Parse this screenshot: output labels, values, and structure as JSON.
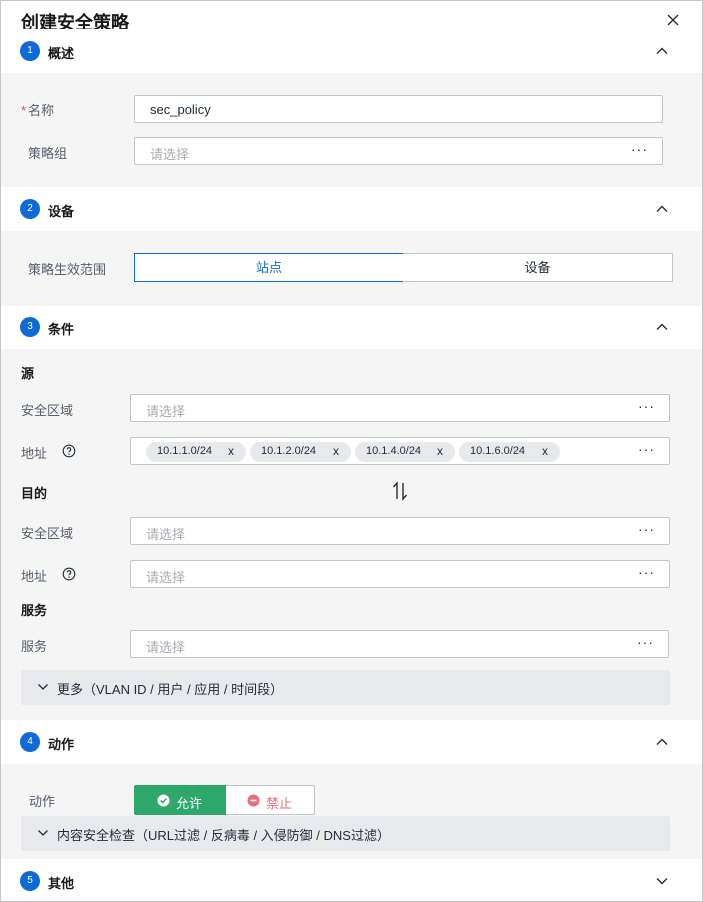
{
  "dialog": {
    "title": "创建安全策略"
  },
  "sections": {
    "overview": {
      "step": "1",
      "title": "概述"
    },
    "device": {
      "step": "2",
      "title": "设备"
    },
    "condition": {
      "step": "3",
      "title": "条件"
    },
    "action": {
      "step": "4",
      "title": "动作"
    },
    "other": {
      "step": "5",
      "title": "其他"
    }
  },
  "overview": {
    "name_required": "*",
    "name_label": "名称",
    "name_value": "sec_policy",
    "group_label": "策略组",
    "group_placeholder": "请选择"
  },
  "device": {
    "scope_label": "策略生效范围",
    "scope_options": [
      "站点",
      "设备"
    ],
    "scope_selected": "站点"
  },
  "condition": {
    "source_title": "源",
    "source_zone_label": "安全区域",
    "source_zone_placeholder": "请选择",
    "source_addr_label": "地址",
    "source_addresses": [
      "10.1.1.0/24",
      "10.1.2.0/24",
      "10.1.4.0/24",
      "10.1.6.0/24"
    ],
    "chip_remove": "x",
    "dest_title": "目的",
    "dest_zone_label": "安全区域",
    "dest_zone_placeholder": "请选择",
    "dest_addr_label": "地址",
    "dest_addr_placeholder": "请选择",
    "service_title": "服务",
    "service_label": "服务",
    "service_placeholder": "请选择",
    "more_label": "更多（VLAN ID / 用户 / 应用 / 时间段）"
  },
  "action": {
    "label": "动作",
    "allow": "允许",
    "deny": "禁止",
    "selected": "允许",
    "content_check": "内容安全检查（URL过滤 / 反病毒 / 入侵防御 / DNS过滤）"
  },
  "colors": {
    "primary": "#0d6ad6",
    "allow_green": "#2ea86a",
    "deny_red": "#e5727a",
    "required_red": "#e54545"
  }
}
